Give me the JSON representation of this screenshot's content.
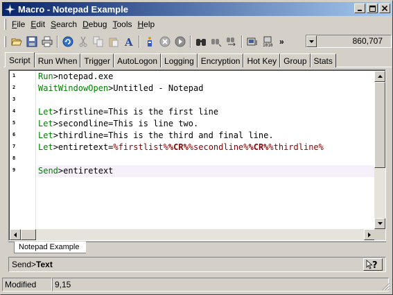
{
  "window": {
    "title": "Macro - Notepad Example"
  },
  "menu": [
    {
      "label": "File",
      "ul": "F",
      "rest": "ile"
    },
    {
      "label": "Edit",
      "ul": "E",
      "rest": "dit"
    },
    {
      "label": "Search",
      "ul": "S",
      "rest": "earch"
    },
    {
      "label": "Debug",
      "ul": "D",
      "rest": "ebug"
    },
    {
      "label": "Tools",
      "ul": "T",
      "rest": "ools"
    },
    {
      "label": "Help",
      "ul": "H",
      "rest": "elp"
    }
  ],
  "toolbar": {
    "icons": [
      "open-icon",
      "save-icon",
      "print-icon",
      "refresh-icon",
      "cut-icon",
      "copy-icon",
      "paste-icon",
      "font-icon",
      "run-icon",
      "stop-icon",
      "step-icon",
      "find-icon",
      "find-next-icon",
      "replace-icon",
      "record-icon",
      "binary-icon"
    ],
    "more": "»",
    "counter_value": "860,707"
  },
  "tabs": [
    "Script",
    "Run When",
    "Trigger",
    "AutoLogon",
    "Logging",
    "Encryption",
    "Hot Key",
    "Group",
    "Stats"
  ],
  "active_tab": "Script",
  "editor": {
    "line_numbers": [
      "1",
      "2",
      "3",
      "4",
      "5",
      "6",
      "7",
      "8",
      "9"
    ],
    "lines": [
      {
        "cmd": "Run",
        "op": ">",
        "rest": "notepad.exe"
      },
      {
        "cmd": "WaitWindowOpen",
        "op": ">",
        "rest": "Untitled - Notepad"
      },
      {
        "cmd": "",
        "op": "",
        "rest": ""
      },
      {
        "cmd": "Let",
        "op": ">",
        "rest": "firstline=This is the first line"
      },
      {
        "cmd": "Let",
        "op": ">",
        "rest": "secondline=This is line two."
      },
      {
        "cmd": "Let",
        "op": ">",
        "rest": "thirdline=This is the third and final line."
      },
      {
        "cmd": "Let",
        "op": ">",
        "rest": "entiretext="
      },
      {
        "cmd": "",
        "op": "",
        "rest": ""
      },
      {
        "cmd": "Send",
        "op": ">",
        "rest": "entiretext"
      }
    ],
    "line7_parts": {
      "a": "%firstlist%",
      "b": "%CR%",
      "c": "%secondline%",
      "d": "%CR%",
      "e": "%thirdline%"
    }
  },
  "doc_tab": "Notepad Example",
  "hint": {
    "prefix": "Send>",
    "bold": "Text"
  },
  "status": {
    "state": "Modified",
    "position": "9,15"
  },
  "colors": {
    "title_start": "#0a246a",
    "title_end": "#a6caf0",
    "command_green": "#008000",
    "variable_red": "#8b0000",
    "current_line": "#f5f0fa"
  }
}
